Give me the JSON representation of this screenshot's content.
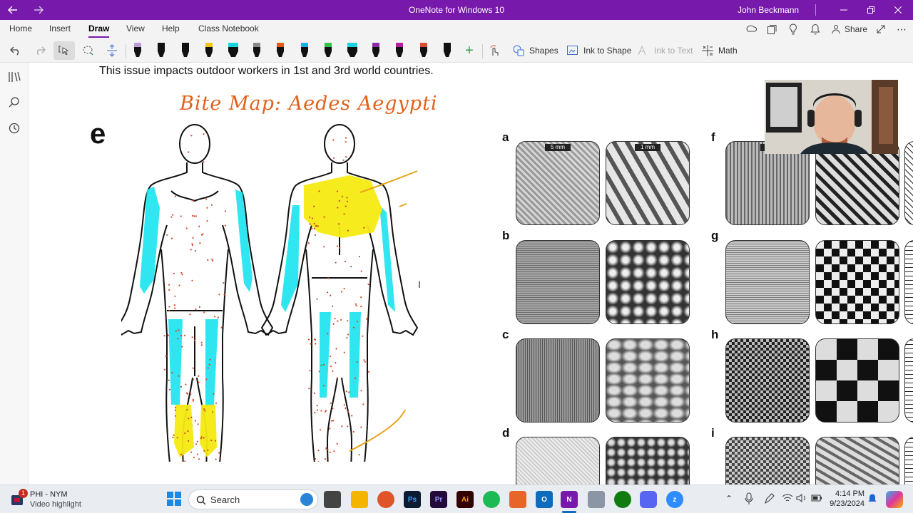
{
  "window": {
    "title": "OneNote for Windows 10",
    "user": "John Beckmann",
    "accent": "#7719aa"
  },
  "ribbon": {
    "tabs": [
      "Home",
      "Insert",
      "Draw",
      "View",
      "Help",
      "Class Notebook"
    ],
    "active_tab": "Draw",
    "share_label": "Share"
  },
  "toolbar": {
    "pens": [
      {
        "color": "#c09bd8",
        "icon": "pen-icon"
      },
      {
        "color": "#111111",
        "icon": "pen-icon"
      },
      {
        "color": "#111111",
        "icon": "pen-icon"
      },
      {
        "color": "#f2c318",
        "icon": "pen-icon"
      },
      {
        "color": "#21d1e0",
        "icon": "highlighter-icon"
      },
      {
        "color": "#888888",
        "icon": "pen-icon"
      },
      {
        "color": "#e55a1c",
        "icon": "pen-icon"
      },
      {
        "color": "#18b4e8",
        "icon": "pen-icon"
      },
      {
        "color": "#33c24b",
        "icon": "pen-icon"
      },
      {
        "color": "#21d1e0",
        "icon": "highlighter-icon"
      },
      {
        "color": "#8a2ba8",
        "icon": "pen-icon"
      },
      {
        "color": "#b51fa5",
        "icon": "pen-icon"
      },
      {
        "color": "#d84f33",
        "icon": "pen-icon"
      },
      {
        "color": "#111111",
        "icon": "pen-icon"
      }
    ],
    "shapes_label": "Shapes",
    "ink_to_shape_label": "Ink to Shape",
    "ink_to_text_label": "Ink to Text",
    "math_label": "Math"
  },
  "page": {
    "note_text": "This issue impacts outdoor workers in 1st and 3rd world countries.",
    "handwriting": "Bite Map:  Aedes Aegypti",
    "figure_label": "e",
    "panel_letters_left": [
      "a",
      "b",
      "c",
      "d"
    ],
    "panel_letters_right": [
      "f",
      "g",
      "h",
      "i"
    ],
    "scale_labels": [
      "5 mm",
      "1 mm",
      "5"
    ]
  },
  "taskbar": {
    "notification_badge": "1",
    "widget_title": "PHI - NYM",
    "widget_subtitle": "Video highlight",
    "search_placeholder": "Search",
    "time": "4:14 PM",
    "date": "9/23/2024"
  }
}
